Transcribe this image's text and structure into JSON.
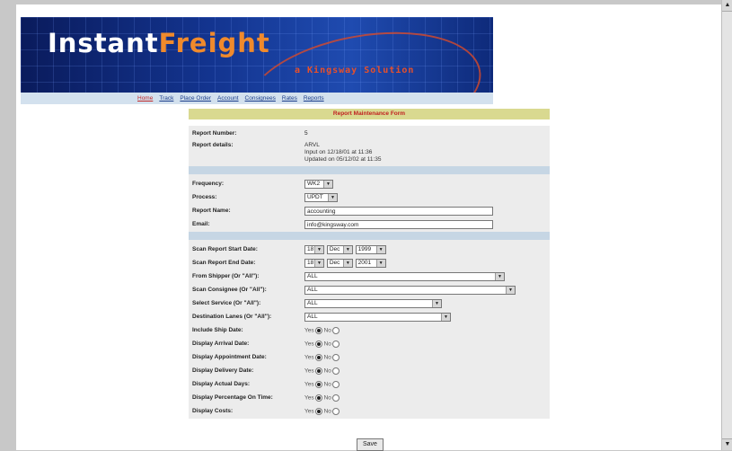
{
  "brand": {
    "word1": "Instant",
    "word2": "Freight",
    "tagline": "a Kingsway Solution"
  },
  "nav": {
    "items": [
      "Home",
      "Track",
      "Place Order",
      "Account",
      "Consignees",
      "Rates",
      "Reports"
    ]
  },
  "form": {
    "title": "Report Maintenance Form",
    "report_number_label": "Report Number:",
    "report_number": "5",
    "report_details_label": "Report details:",
    "details": [
      "ARVL",
      "Input on 12/18/01 at 11:36",
      "Updated on 05/12/02 at 11:35"
    ],
    "frequency_label": "Frequency:",
    "frequency": "WK2",
    "process_label": "Process:",
    "process": "UPDT",
    "report_name_label": "Report Name:",
    "report_name": "accounting",
    "email_label": "Email:",
    "email": "info@kingsway.com",
    "start_label": "Scan Report Start Date:",
    "start": {
      "day": "18",
      "month": "Dec",
      "year": "1999"
    },
    "end_label": "Scan Report End Date:",
    "end": {
      "day": "18",
      "month": "Dec",
      "year": "2001"
    },
    "shipper_label": "From Shipper (Or \"All\"):",
    "shipper": "ALL",
    "consignee_label": "Scan Consignee (Or \"All\"):",
    "consignee": "ALL",
    "service_label": "Select Service (Or \"All\"):",
    "service": "ALL",
    "lanes_label": "Destination Lanes (Or \"All\"):",
    "lanes": "ALL",
    "yes": "Yes",
    "no": "No",
    "yesno": [
      {
        "label": "Include Ship Date:",
        "value": "Yes"
      },
      {
        "label": "Display Arrival Date:",
        "value": "Yes"
      },
      {
        "label": "Display Appointment Date:",
        "value": "Yes"
      },
      {
        "label": "Display Delivery Date:",
        "value": "Yes"
      },
      {
        "label": "Display Actual Days:",
        "value": "Yes"
      },
      {
        "label": "Display Percentage On Time:",
        "value": "Yes"
      },
      {
        "label": "Display Costs:",
        "value": "Yes"
      }
    ],
    "save_label": "Save"
  }
}
